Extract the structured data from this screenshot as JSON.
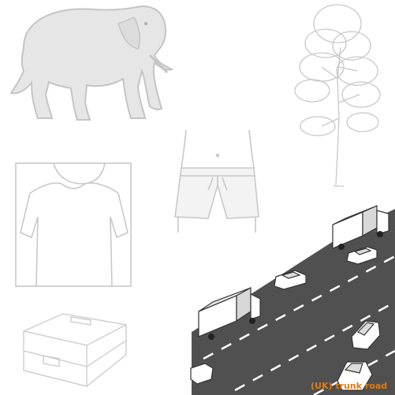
{
  "scene": {
    "caption": "(UK) trunk road",
    "highlight_color": "#e07b12",
    "road_color": "#505050",
    "outline_color": "#c8c8c8"
  },
  "icons": [
    "elephant-icon",
    "tree-icon",
    "shorts-icon",
    "tshirt-icon",
    "suitcase-icon",
    "trunk-road-illustration"
  ]
}
